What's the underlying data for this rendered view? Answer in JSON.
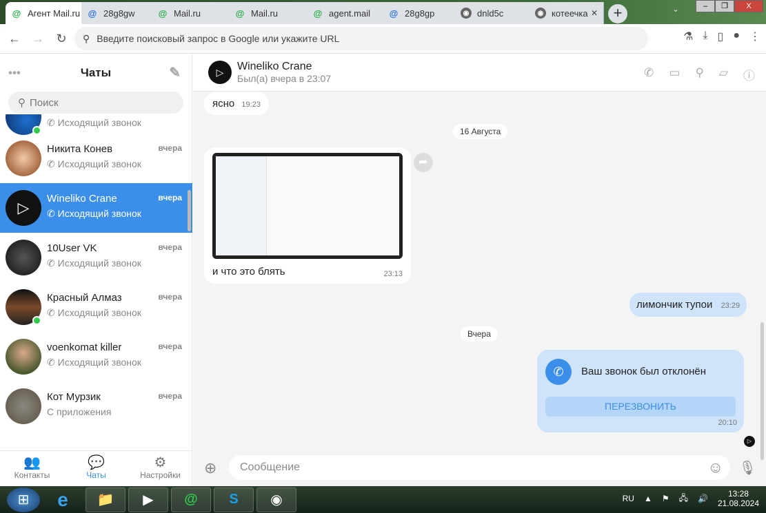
{
  "browser": {
    "tabs": [
      {
        "label": "Агент Mail.ru",
        "icon": "mail-at-green"
      },
      {
        "label": "28g8gw",
        "icon": "at-blue"
      },
      {
        "label": "Mail.ru",
        "icon": "mail-at-green"
      },
      {
        "label": "Mail.ru",
        "icon": "mail-at-green"
      },
      {
        "label": "agent.mail",
        "icon": "mail-at-green"
      },
      {
        "label": "28g8gp",
        "icon": "at-blue"
      },
      {
        "label": "dnld5c",
        "icon": "globe"
      },
      {
        "label": "котеечка",
        "icon": "globe"
      }
    ],
    "omnibox_placeholder": "Введите поисковый запрос в Google или укажите URL"
  },
  "sidebar": {
    "title": "Чаты",
    "search_placeholder": "Поиск",
    "chats": [
      {
        "name": "",
        "sub": "Исходящий звонок",
        "time": "",
        "online": true
      },
      {
        "name": "Никита Конев",
        "sub": "Исходящий звонок",
        "time": "вчера",
        "online": false
      },
      {
        "name": "Wineliko Crane",
        "sub": "Исходящий звонок",
        "time": "вчера",
        "online": false,
        "selected": true
      },
      {
        "name": "10User VK",
        "sub": "Исходящий звонок",
        "time": "вчера",
        "online": false
      },
      {
        "name": "Красный Алмаз",
        "sub": "Исходящий звонок",
        "time": "вчера",
        "online": true
      },
      {
        "name": "voenkomat killer",
        "sub": "Исходящий звонок",
        "time": "вчера",
        "online": false
      },
      {
        "name": "Кот Мурзик",
        "sub": "С приложения",
        "time": "вчера",
        "online": false
      }
    ],
    "nav": [
      {
        "label": "Контакты"
      },
      {
        "label": "Чаты"
      },
      {
        "label": "Настройки"
      }
    ]
  },
  "chat": {
    "name": "Wineliko Crane",
    "status": "Был(а) вчера в 23:07",
    "messages": [
      {
        "text": "ясно",
        "time": "19:23"
      },
      {
        "date": "16 Августа"
      },
      {
        "text": "и что это блять",
        "time": "23:13"
      },
      {
        "text": "лимончик тупои",
        "time": "23:29"
      },
      {
        "date": "Вчера"
      },
      {
        "text": "Ваш звонок был отклонён",
        "button": "ПЕРЕЗВОНИТЬ",
        "time": "20:10"
      }
    ],
    "input_placeholder": "Сообщение"
  },
  "taskbar": {
    "lang": "RU",
    "time": "13:28",
    "date": "21.08.2024"
  }
}
